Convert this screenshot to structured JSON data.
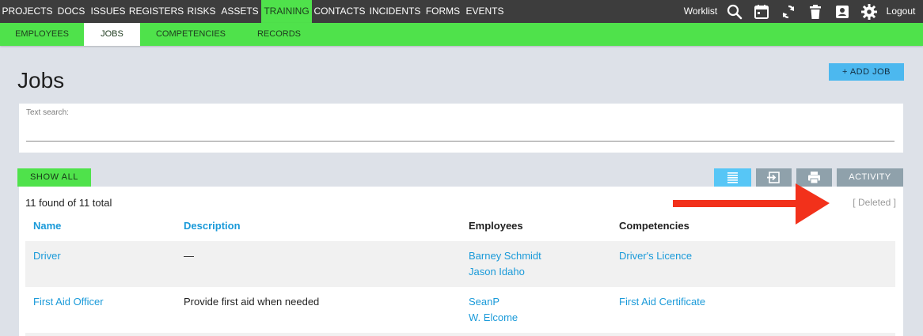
{
  "topnav": {
    "items": [
      "PROJECTS",
      "DOCS",
      "ISSUES",
      "REGISTERS",
      "RISKS",
      "ASSETS",
      "TRAINING",
      "CONTACTS",
      "INCIDENTS",
      "FORMS",
      "EVENTS"
    ],
    "worklist": "Worklist",
    "logout": "Logout",
    "icons": [
      "search-icon",
      "calendar-icon",
      "sync-icon",
      "trash-icon",
      "contact-card-icon",
      "gear-icon"
    ],
    "active_color": "#4fe24b"
  },
  "subnav": {
    "items": [
      "EMPLOYEES",
      "JOBS",
      "COMPETENCIES",
      "RECORDS"
    ],
    "active": "JOBS"
  },
  "page": {
    "title": "Jobs",
    "add_button": "+ ADD JOB"
  },
  "search": {
    "label": "Text search:",
    "value": ""
  },
  "toolbar": {
    "show_all": "SHOW ALL",
    "activity": "ACTIVITY",
    "icons": [
      "list-view-icon",
      "export-icon",
      "print-icon"
    ]
  },
  "results": {
    "count_text": "11 found of 11 total",
    "deleted_link": "[ Deleted ]"
  },
  "table": {
    "columns": [
      "Name",
      "Description",
      "Employees",
      "Competencies"
    ],
    "rows": [
      {
        "name": "Driver",
        "description": "—",
        "employees": [
          "Barney Schmidt",
          "Jason Idaho"
        ],
        "competencies": [
          "Driver's Licence"
        ]
      },
      {
        "name": "First Aid Officer",
        "description": "Provide first aid when needed",
        "employees": [
          "SeanP",
          "W. Elcome"
        ],
        "competencies": [
          "First Aid Certificate"
        ]
      }
    ]
  },
  "colors": {
    "link": "#1a9ad9",
    "accent_green": "#4fe24b",
    "accent_blue": "#4cb8ef",
    "annotation_arrow": "#f2311b"
  }
}
